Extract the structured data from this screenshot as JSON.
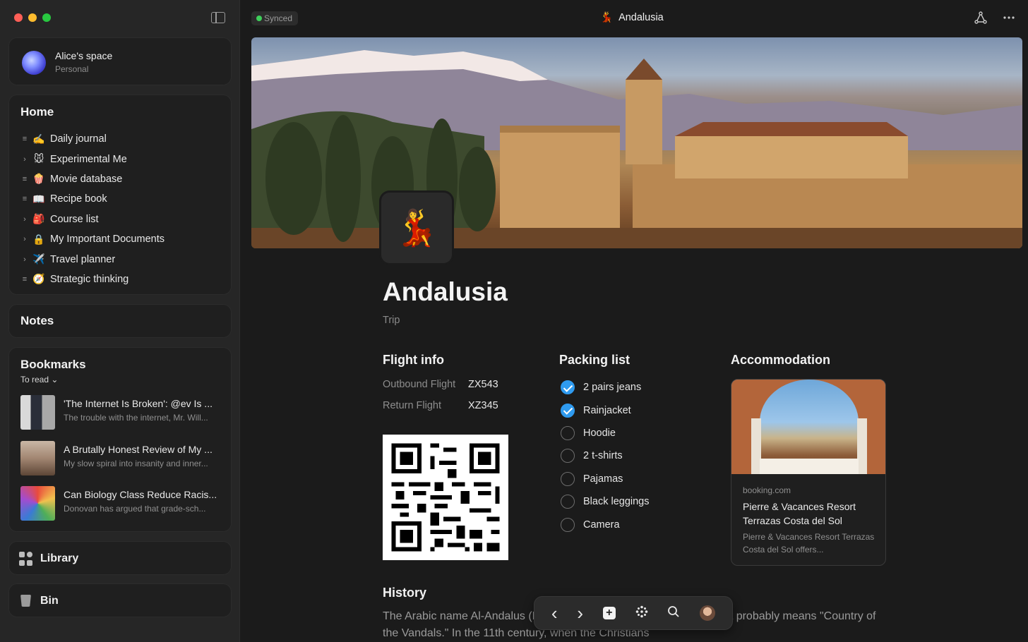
{
  "sidebar": {
    "space": {
      "name": "Alice's space",
      "type": "Personal"
    },
    "home": {
      "title": "Home",
      "items": [
        {
          "caret": "≡",
          "emoji": "✍️",
          "label": "Daily journal"
        },
        {
          "caret": "›",
          "emoji": "🐭",
          "label": "Experimental Me"
        },
        {
          "caret": "≡",
          "emoji": "🍿",
          "label": "Movie database"
        },
        {
          "caret": "≡",
          "emoji": "📖",
          "label": "Recipe book"
        },
        {
          "caret": "›",
          "emoji": "🎒",
          "label": "Course list"
        },
        {
          "caret": "›",
          "emoji": "🔒",
          "label": "My Important Documents"
        },
        {
          "caret": "›",
          "emoji": "✈️",
          "label": "Travel planner"
        },
        {
          "caret": "≡",
          "emoji": "🧭",
          "label": "Strategic thinking"
        }
      ]
    },
    "notes": {
      "title": "Notes"
    },
    "bookmarks": {
      "title": "Bookmarks",
      "filter": "To read ⌄",
      "items": [
        {
          "title": "'The Internet Is Broken': @ev Is ...",
          "desc": "The trouble with the internet, Mr. Will..."
        },
        {
          "title": "A Brutally Honest Review of My ...",
          "desc": "My slow spiral into insanity and inner..."
        },
        {
          "title": "Can Biology Class Reduce Racis...",
          "desc": "Donovan has argued that grade-sch..."
        }
      ]
    },
    "library": {
      "label": "Library"
    },
    "bin": {
      "label": "Bin"
    }
  },
  "topbar": {
    "sync_status": "Synced",
    "title_emoji": "💃",
    "title": "Andalusia"
  },
  "page": {
    "icon": "💃",
    "title": "Andalusia",
    "subtitle": "Trip",
    "flight": {
      "heading": "Flight info",
      "rows": [
        {
          "label": "Outbound Flight",
          "value": "ZX543"
        },
        {
          "label": "Return Flight",
          "value": "XZ345"
        }
      ]
    },
    "packing": {
      "heading": "Packing list",
      "items": [
        {
          "label": "2 pairs jeans",
          "checked": true
        },
        {
          "label": "Rainjacket",
          "checked": true
        },
        {
          "label": "Hoodie",
          "checked": false
        },
        {
          "label": "2 t-shirts",
          "checked": false
        },
        {
          "label": "Pajamas",
          "checked": false
        },
        {
          "label": "Black leggings",
          "checked": false
        },
        {
          "label": "Camera",
          "checked": false
        }
      ]
    },
    "accommodation": {
      "heading": "Accommodation",
      "domain": "booking.com",
      "title": "Pierre & Vacances Resort Terrazas Costa del Sol",
      "desc": "Pierre & Vacances Resort Terrazas Costa del Sol offers..."
    },
    "history": {
      "heading": "History",
      "text": "The Arabic name Al-Andalus (Moors) to the entire Iberian Peninsula. It probably means \"Country of the Vandals.\" In the 11th century, when the Christians"
    }
  },
  "toolbar": {
    "back": "‹",
    "forward": "›",
    "add": "+",
    "search": "⌕"
  },
  "colors": {
    "accent": "#2f9bf0",
    "synced": "#3ecf5a",
    "background": "#1b1b1b"
  }
}
